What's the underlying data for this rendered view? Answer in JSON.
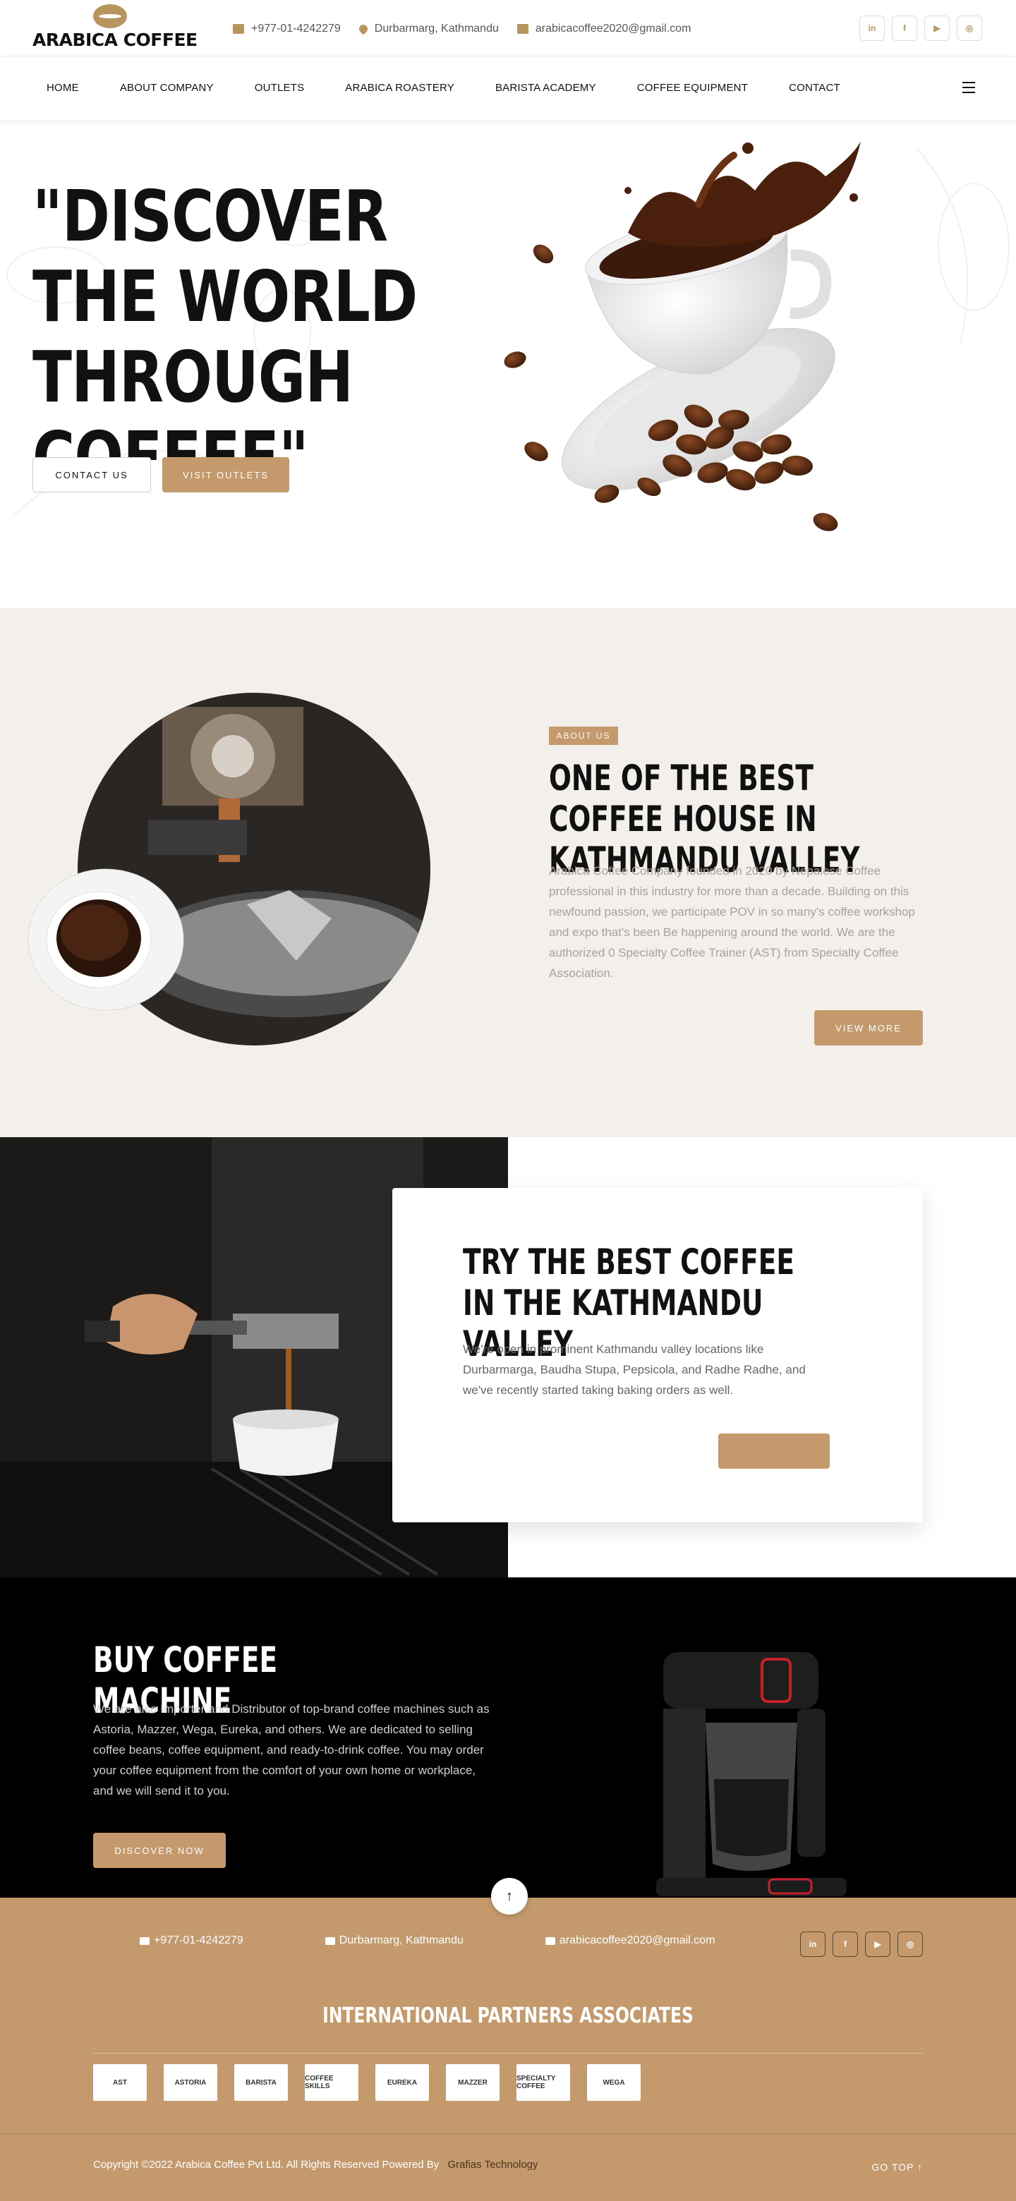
{
  "header": {
    "logo_text": "ARABICA COFFEE",
    "phone": "+977-01-4242279",
    "address": "Durbarmarg, Kathmandu",
    "email": "arabicacoffee2020@gmail.com",
    "social": [
      "in",
      "f",
      "▶",
      "◎"
    ]
  },
  "nav": {
    "items": [
      "HOME",
      "ABOUT COMPANY",
      "OUTLETS",
      "ARABICA ROASTERY",
      "BARISTA ACADEMY",
      "COFFEE EQUIPMENT",
      "CONTACT"
    ]
  },
  "hero": {
    "title": "\"DISCOVER THE WORLD THROUGH COFFEE\"",
    "btn_contact": "CONTACT US",
    "btn_outlets": "VISIT OUTLETS"
  },
  "about": {
    "tag": "ABOUT US",
    "title": "ONE OF THE BEST COFFEE HOUSE IN KATHMANDU VALLEY",
    "text": "Arabica Coffee Company founded in 2020 by Nepalese Coffee professional in this industry for more than a decade. Building on this newfound passion, we participate POV in so many's coffee workshop and expo that's been Be happening around the world. We are the authorized 0 Specialty Coffee Trainer (AST) from Specialty Coffee Association.",
    "btn": "VIEW MORE"
  },
  "try": {
    "title": "TRY THE BEST COFFEE IN THE KATHMANDU VALLEY",
    "text": "We're open in prominent Kathmandu valley locations like Durbarmarga, Baudha Stupa, Pepsicola, and Radhe Radhe, and we've recently started taking baking orders as well."
  },
  "machine": {
    "title": "BUY COFFEE MACHINE",
    "text": "We are also Importer and Distributor of top-brand coffee machines such as Astoria, Mazzer, Wega, Eureka, and others. We are dedicated to selling coffee beans, coffee equipment, and ready-to-drink coffee. You may order your coffee equipment from the comfort of your own home or workplace, and we will send it to you.",
    "btn": "DISCOVER NOW"
  },
  "scroll_up": "↑",
  "footer": {
    "phone": "+977-01-4242279",
    "address": "Durbarmarg, Kathmandu",
    "email": "arabicacoffee2020@gmail.com",
    "social": [
      "in",
      "f",
      "▶",
      "◎"
    ],
    "partners_title": "INTERNATIONAL PARTNERS ASSOCIATES",
    "partners": [
      "AST",
      "Astoria",
      "Barista",
      "Coffee Skills",
      "Eureka",
      "Mazzer",
      "Specialty Coffee",
      "Wega"
    ],
    "copyright": "Copyright ©2022 Arabica Coffee Pvt Ltd. All Rights Reserved",
    "powered_by": "Powered By",
    "powered_link": "Grafias Technology",
    "go_top": "GO TOP ↑"
  },
  "colors": {
    "accent": "#c49a6c",
    "about_bg": "#f3efeb",
    "machine_bg": "#000000"
  }
}
